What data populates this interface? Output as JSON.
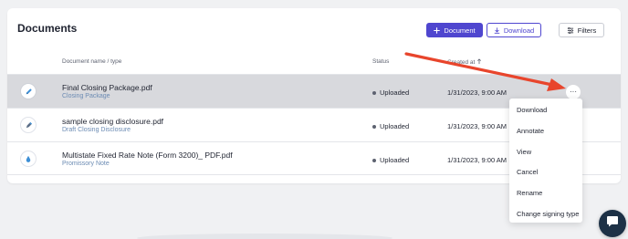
{
  "page": {
    "title": "Documents"
  },
  "toolbar": {
    "document_label": "Document",
    "download_label": "Download",
    "filters_label": "Filters"
  },
  "table": {
    "headers": {
      "name": "Document name / type",
      "status": "Status",
      "created": "Created at"
    },
    "rows": [
      {
        "name": "Final Closing Package.pdf",
        "type": "Closing Package",
        "status": "Uploaded",
        "created": "1/31/2023, 9:00 AM",
        "icon": "pencil-icon",
        "active": true
      },
      {
        "name": "sample closing disclosure.pdf",
        "type": "Draft Closing Disclosure",
        "status": "Uploaded",
        "created": "1/31/2023, 9:00 AM",
        "icon": "pen-nib-icon",
        "active": false
      },
      {
        "name": "Multistate Fixed Rate Note (Form 3200)_ PDF.pdf",
        "type": "Promissory Note",
        "status": "Uploaded",
        "created": "1/31/2023, 9:00 AM",
        "icon": "droplet-icon",
        "active": false
      }
    ]
  },
  "row_menu": {
    "more_label": "···",
    "items": [
      "Download",
      "Annotate",
      "View",
      "Cancel",
      "Rename",
      "Change signing type"
    ]
  },
  "colors": {
    "primary": "#4f46cf",
    "annotation_arrow": "#e8452c",
    "chat_button": "#1d3146"
  }
}
